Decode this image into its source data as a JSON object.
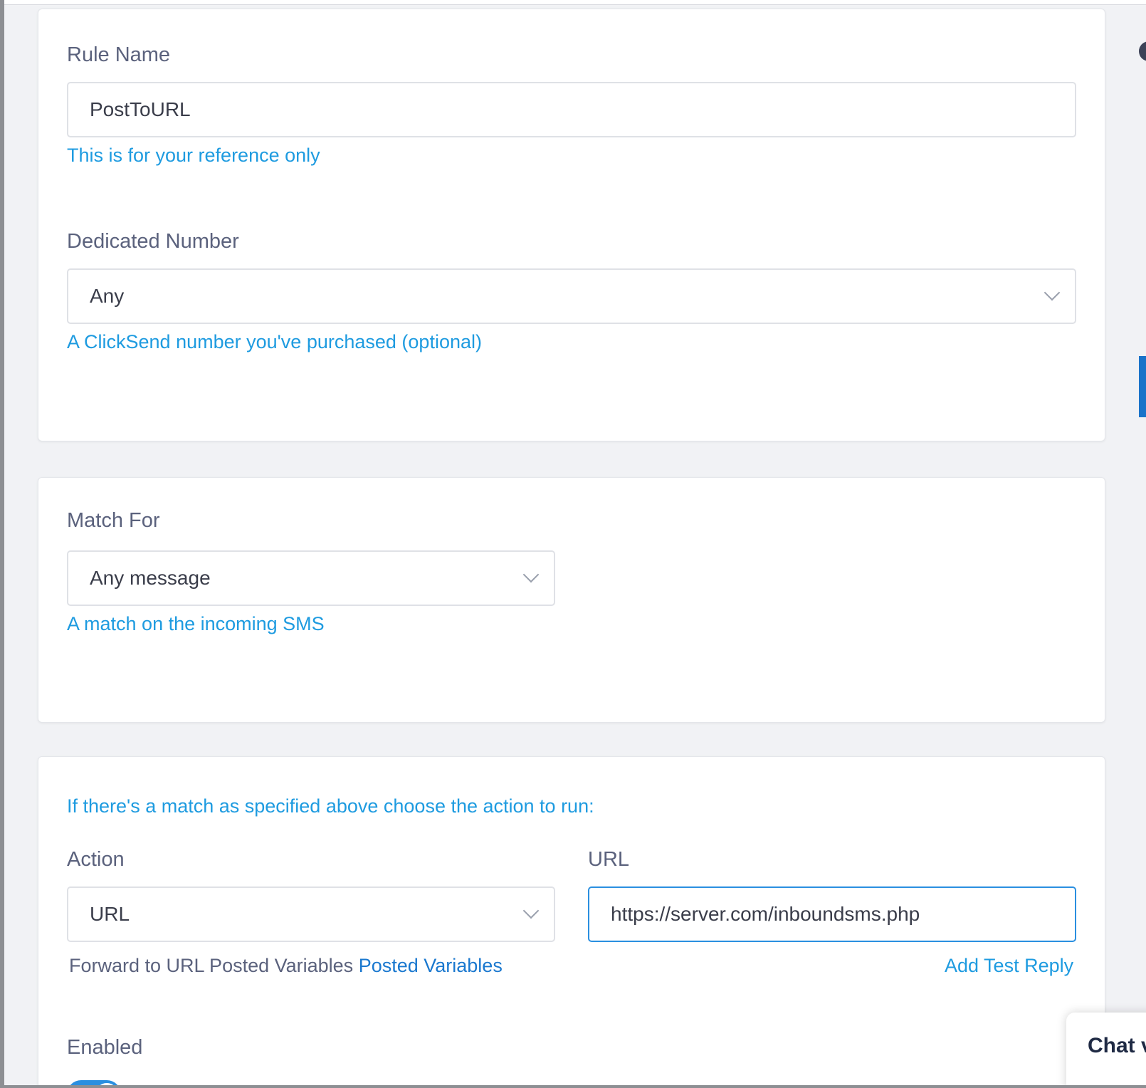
{
  "rule_name": {
    "label": "Rule Name",
    "value": "PostToURL",
    "hint": "This is for your reference only"
  },
  "dedicated_number": {
    "label": "Dedicated Number",
    "selected": "Any",
    "hint": "A ClickSend number you've purchased (optional)"
  },
  "match_for": {
    "label": "Match For",
    "selected": "Any message",
    "hint": "A match on the incoming SMS"
  },
  "action_section": {
    "intro": "If there's a match as specified above choose the action to run:",
    "action_label": "Action",
    "action_selected": "URL",
    "url_label": "URL",
    "url_value": "https://server.com/inboundsms.php",
    "forward_text": "Forward to URL Posted Variables",
    "posted_variables_link": "Posted Variables",
    "add_test_reply": "Add Test Reply",
    "enabled_label": "Enabled",
    "enabled": true
  },
  "chat_widget": {
    "label": "Chat v"
  },
  "colors": {
    "hint": "#1e9be0",
    "link": "#1a78cf",
    "label": "#5b627d",
    "focus_border": "#2a8fe0"
  }
}
